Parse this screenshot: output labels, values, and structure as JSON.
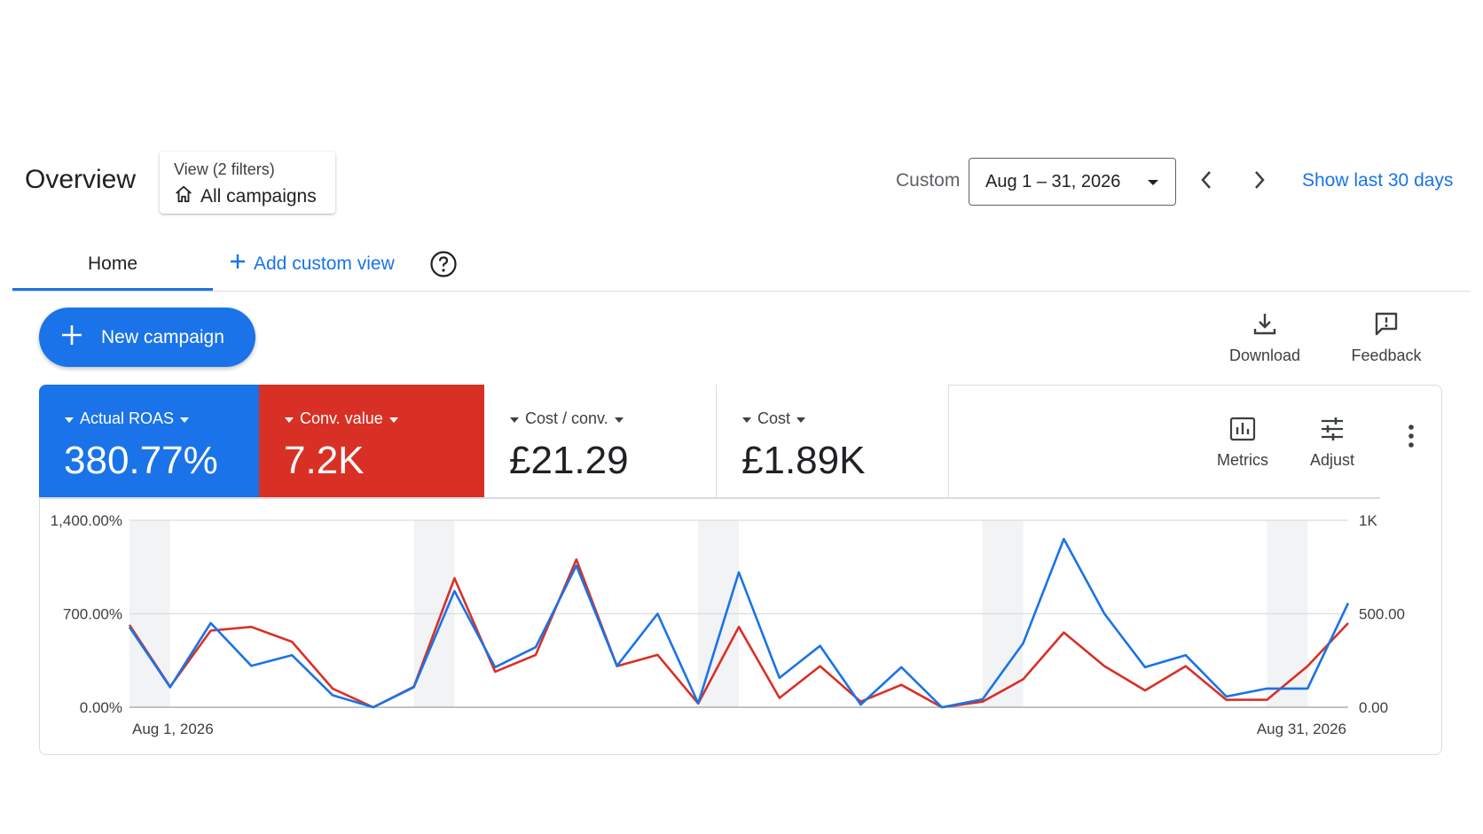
{
  "header": {
    "title": "Overview",
    "view_filter_label": "View (2 filters)",
    "view_name": "All campaigns",
    "date_mode_label": "Custom",
    "date_range": "Aug 1 – 31, 2026",
    "show_last_label": "Show last 30 days"
  },
  "tabs": {
    "home_label": "Home",
    "add_custom_view_label": "Add custom view"
  },
  "actions": {
    "new_campaign_label": "New campaign",
    "download_label": "Download",
    "feedback_label": "Feedback",
    "metrics_label": "Metrics",
    "adjust_label": "Adjust"
  },
  "metrics": [
    {
      "label": "Actual ROAS",
      "value": "380.77%",
      "color": "#1a73e8"
    },
    {
      "label": "Conv. value",
      "value": "7.2K",
      "color": "#d93025"
    },
    {
      "label": "Cost / conv.",
      "value": "£21.29"
    },
    {
      "label": "Cost",
      "value": "£1.89K"
    }
  ],
  "colors": {
    "accent": "#1a73e8",
    "red": "#d93025"
  },
  "chart_data": {
    "type": "line",
    "x": [
      "Aug 1, 2026",
      "Aug 2",
      "Aug 3",
      "Aug 4",
      "Aug 5",
      "Aug 6",
      "Aug 7",
      "Aug 8",
      "Aug 9",
      "Aug 10",
      "Aug 11",
      "Aug 12",
      "Aug 13",
      "Aug 14",
      "Aug 15",
      "Aug 16",
      "Aug 17",
      "Aug 18",
      "Aug 19",
      "Aug 20",
      "Aug 21",
      "Aug 22",
      "Aug 23",
      "Aug 24",
      "Aug 25",
      "Aug 26",
      "Aug 27",
      "Aug 28",
      "Aug 29",
      "Aug 30",
      "Aug 31, 2026"
    ],
    "x_tick_labels": [
      "Aug 1, 2026",
      "Aug 31, 2026"
    ],
    "y_left_ticks": [
      "1,400.00%",
      "700.00%",
      "0.00%"
    ],
    "y_right_ticks": [
      "1K",
      "500.00",
      "0.00"
    ],
    "y_left_range": [
      0,
      1400
    ],
    "y_right_range": [
      0,
      1000
    ],
    "grid": true,
    "series": [
      {
        "name": "Actual ROAS",
        "axis": "left",
        "color": "#1a73e8",
        "values": [
          600,
          150,
          630,
          310,
          390,
          90,
          0,
          150,
          870,
          300,
          450,
          1060,
          310,
          700,
          30,
          1010,
          220,
          460,
          20,
          300,
          0,
          60,
          480,
          1260,
          700,
          300,
          390,
          80,
          140,
          140,
          780
        ]
      },
      {
        "name": "Conv. value",
        "axis": "right",
        "color": "#d93025",
        "values": [
          440,
          110,
          410,
          430,
          350,
          100,
          0,
          110,
          690,
          190,
          280,
          790,
          220,
          280,
          20,
          430,
          50,
          220,
          30,
          120,
          0,
          30,
          150,
          400,
          220,
          90,
          220,
          40,
          40,
          220,
          450
        ]
      }
    ],
    "weekend_bands": [
      [
        0,
        1
      ],
      [
        7,
        8
      ],
      [
        14,
        15
      ],
      [
        21,
        22
      ],
      [
        28,
        29
      ]
    ]
  }
}
